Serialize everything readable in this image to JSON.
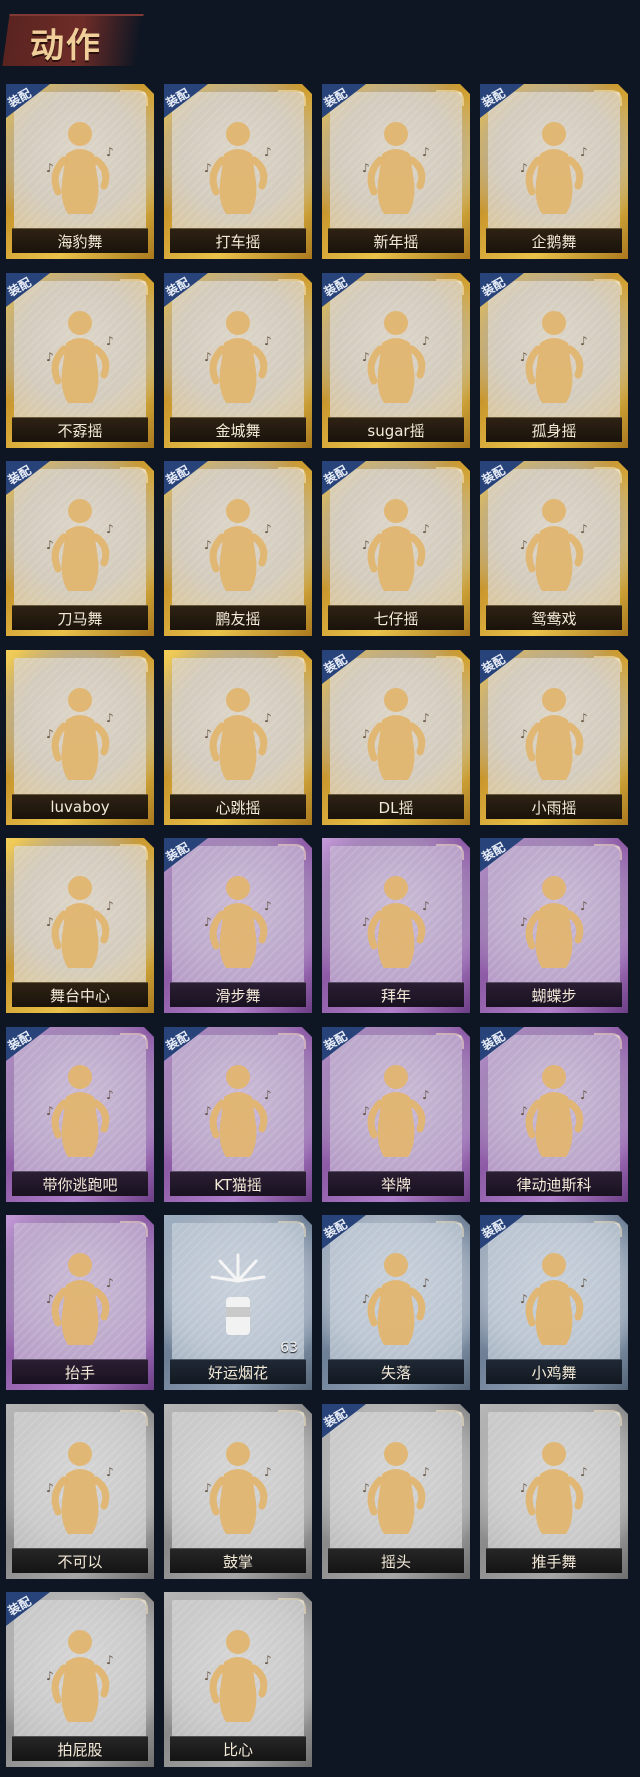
{
  "header": {
    "title": "动作"
  },
  "equip_label": "装配",
  "actions": [
    {
      "label": "海豹舞",
      "tier": "gold",
      "equipped": true
    },
    {
      "label": "打车摇",
      "tier": "gold",
      "equipped": true
    },
    {
      "label": "新年摇",
      "tier": "gold",
      "equipped": true
    },
    {
      "label": "企鹅舞",
      "tier": "gold",
      "equipped": true
    },
    {
      "label": "不孬摇",
      "tier": "gold",
      "equipped": true
    },
    {
      "label": "金城舞",
      "tier": "gold",
      "equipped": true
    },
    {
      "label": "sugar摇",
      "tier": "gold",
      "equipped": true
    },
    {
      "label": "孤身摇",
      "tier": "gold",
      "equipped": true
    },
    {
      "label": "刀马舞",
      "tier": "gold",
      "equipped": true
    },
    {
      "label": "鹏友摇",
      "tier": "gold",
      "equipped": true
    },
    {
      "label": "七仔摇",
      "tier": "gold",
      "equipped": true
    },
    {
      "label": "鸳鸯戏",
      "tier": "gold",
      "equipped": true
    },
    {
      "label": "luvaboy",
      "tier": "gold",
      "equipped": false
    },
    {
      "label": "心跳摇",
      "tier": "gold",
      "equipped": false
    },
    {
      "label": "DL摇",
      "tier": "gold",
      "equipped": true
    },
    {
      "label": "小雨摇",
      "tier": "gold",
      "equipped": true
    },
    {
      "label": "舞台中心",
      "tier": "gold",
      "equipped": false
    },
    {
      "label": "滑步舞",
      "tier": "purple",
      "equipped": true
    },
    {
      "label": "拜年",
      "tier": "purple",
      "equipped": false
    },
    {
      "label": "蝴蝶步",
      "tier": "purple",
      "equipped": true
    },
    {
      "label": "带你逃跑吧",
      "tier": "purple",
      "equipped": true
    },
    {
      "label": "KT猫摇",
      "tier": "purple",
      "equipped": true
    },
    {
      "label": "举牌",
      "tier": "purple",
      "equipped": true
    },
    {
      "label": "律动迪斯科",
      "tier": "purple",
      "equipped": true
    },
    {
      "label": "抬手",
      "tier": "purple",
      "equipped": false
    },
    {
      "label": "好运烟花",
      "tier": "blue",
      "equipped": false,
      "count": "63",
      "icon": "firework-icon"
    },
    {
      "label": "失落",
      "tier": "blue",
      "equipped": true
    },
    {
      "label": "小鸡舞",
      "tier": "blue",
      "equipped": true
    },
    {
      "label": "不可以",
      "tier": "gray",
      "equipped": false
    },
    {
      "label": "鼓掌",
      "tier": "gray",
      "equipped": false
    },
    {
      "label": "摇头",
      "tier": "gray",
      "equipped": true
    },
    {
      "label": "推手舞",
      "tier": "gray",
      "equipped": false
    },
    {
      "label": "拍屁股",
      "tier": "gray",
      "equipped": true
    },
    {
      "label": "比心",
      "tier": "gray",
      "equipped": false
    }
  ],
  "colors": {
    "background": "#0e1623",
    "gold": "#d8a93c",
    "purple": "#9b6bb6",
    "blue": "#7c8fa6",
    "gray": "#9a9a9a",
    "badge": "#28437a"
  }
}
